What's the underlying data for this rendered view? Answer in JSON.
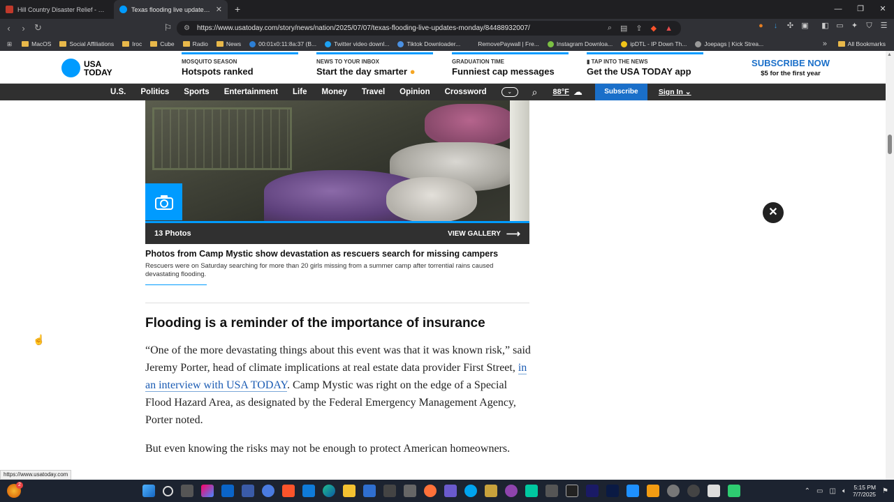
{
  "browser": {
    "tabs": [
      {
        "title": "Hill Country Disaster Relief - KTSA",
        "active": false
      },
      {
        "title": "Texas flooding live updates: New",
        "active": true
      }
    ],
    "new_tab_symbol": "+",
    "url": "https://www.usatoday.com/story/news/nation/2025/07/07/texas-flooding-live-updates-monday/84488932007/",
    "bookmarks": [
      "MacOS",
      "Social Affiliations",
      "Iroc",
      "Cube",
      "Radio",
      "News",
      "00:01x0:11:8a:37 (B...",
      "Twitter video downl...",
      "Tiktok Downloader...",
      "RemovePaywall | Fre...",
      "Instagram Downloa...",
      "ipDTL - IP Down Th...",
      "Joepags | Kick Strea..."
    ],
    "all_bookmarks": "All Bookmarks",
    "more_bookmarks": "»",
    "status_url": "https://www.usatoday.com"
  },
  "site": {
    "logo_line1": "USA",
    "logo_line2": "TODAY",
    "promos": [
      {
        "kicker": "MOSQUITO SEASON",
        "headline": "Hotspots ranked"
      },
      {
        "kicker": "NEWS TO YOUR INBOX",
        "headline": "Start the day smarter"
      },
      {
        "kicker": "GRADUATION TIME",
        "headline": "Funniest cap messages"
      },
      {
        "kicker": "TAP INTO THE NEWS",
        "headline": "Get the USA TODAY app"
      }
    ],
    "subscribe_now": "SUBSCRIBE NOW",
    "subscribe_price": "$5 for the first year",
    "nav": [
      "U.S.",
      "Politics",
      "Sports",
      "Entertainment",
      "Life",
      "Money",
      "Travel",
      "Opinion",
      "Crossword"
    ],
    "temperature": "88°F",
    "subscribe_label": "Subscribe",
    "signin_label": "Sign In"
  },
  "article": {
    "gallery_count": "13 Photos",
    "view_gallery": "VIEW GALLERY",
    "caption_title": "Photos from Camp Mystic show devastation as rescuers search for missing campers",
    "caption_text": "Rescuers were on Saturday searching for more than 20 girls missing from a summer camp after torrential rains caused devastating flooding.",
    "heading": "Flooding is a reminder of the importance of insurance",
    "p1_a": "“One of the more devastating things about this event was that it was known risk,” said Jeremy Porter, head of climate implications at real estate data provider First Street, ",
    "p1_link": "in an interview with USA TODAY",
    "p1_b": ". Camp Mystic was right on the edge of a Special Flood Hazard Area, as designated by the Federal Emergency Management Agency, Porter noted.",
    "p2": "But even knowing the risks may not be enough to protect American homeowners."
  },
  "taskbar": {
    "time": "5:15 PM",
    "date": "7/7/2025",
    "notification_count": "2"
  },
  "colors": {
    "accent": "#009bff",
    "nav_bg": "#303030",
    "subscribe_bg": "#1a6fc9"
  }
}
